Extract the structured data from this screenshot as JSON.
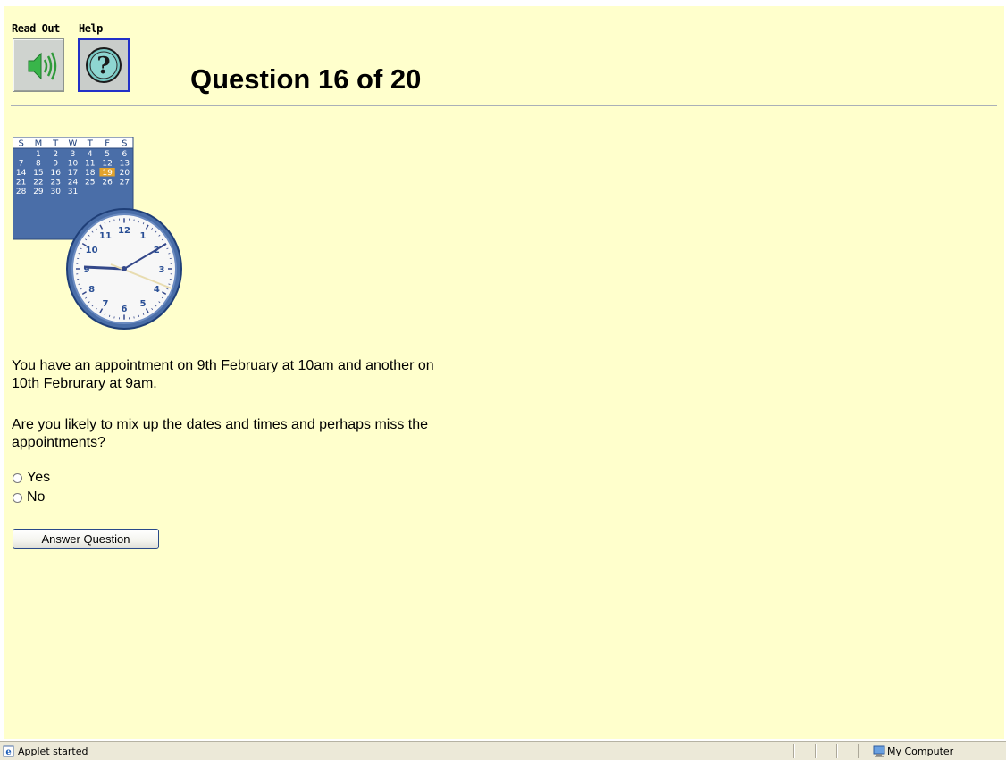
{
  "toolbar": {
    "readout_label": "Read Out",
    "help_label": "Help"
  },
  "question": {
    "title": "Question 16 of 20",
    "text_line1": "You have an appointment on 9th February at 10am and another on 10th Februrary at 9am.",
    "text_line2": "Are you likely to mix up the dates and times and perhaps miss the appointments?"
  },
  "calendar": {
    "weekday_headers": [
      "S",
      "M",
      "T",
      "W",
      "T",
      "F",
      "S"
    ],
    "rows": [
      [
        "",
        "1",
        "2",
        "3",
        "4",
        "5",
        "6"
      ],
      [
        "7",
        "8",
        "9",
        "10",
        "11",
        "12",
        "13"
      ],
      [
        "14",
        "15",
        "16",
        "17",
        "18",
        "19",
        "20"
      ],
      [
        "21",
        "22",
        "23",
        "24",
        "25",
        "26",
        "27"
      ],
      [
        "28",
        "29",
        "30",
        "31",
        "",
        "",
        ""
      ]
    ],
    "highlighted_day": "19"
  },
  "clock": {
    "numbers": [
      "12",
      "1",
      "2",
      "3",
      "4",
      "5",
      "6",
      "7",
      "8",
      "9",
      "10",
      "11"
    ]
  },
  "options": {
    "yes_label": "Yes",
    "no_label": "No"
  },
  "answer_button_label": "Answer Question",
  "statusbar": {
    "status_text": "Applet started",
    "zone_text": "My Computer"
  },
  "colors": {
    "page_background": "#ffffcc",
    "calendar_blue": "#4a6ea8",
    "highlight": "#e3a32c",
    "clock_blue": "#2a4f95"
  },
  "icons": [
    "speaker-icon",
    "help-question-icon",
    "calendar-icon",
    "clock-icon",
    "ie-page-icon",
    "my-computer-icon"
  ]
}
